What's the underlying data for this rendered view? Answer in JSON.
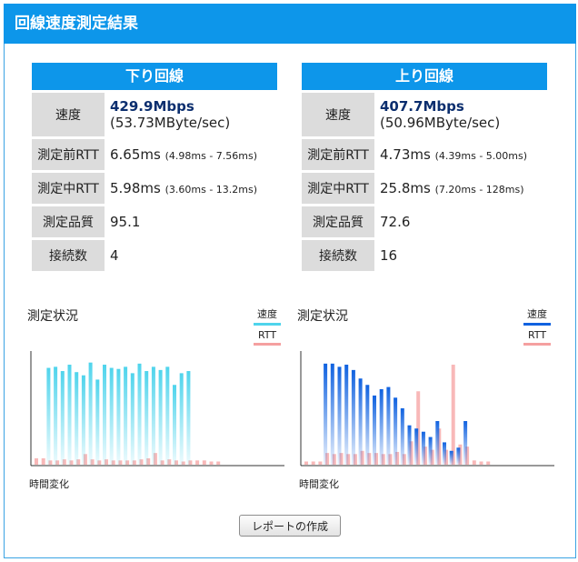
{
  "header": {
    "title": "回線速度測定結果"
  },
  "download": {
    "title": "下り回線",
    "speed_label": "速度",
    "speed_value": "429.9Mbps",
    "speed_sub": "(53.73MByte/sec)",
    "rtt_before_label": "測定前RTT",
    "rtt_before_value": "6.65ms",
    "rtt_before_range": "(4.98ms - 7.56ms)",
    "rtt_during_label": "測定中RTT",
    "rtt_during_value": "5.98ms",
    "rtt_during_range": "(3.60ms - 13.2ms)",
    "quality_label": "測定品質",
    "quality_value": "95.1",
    "connections_label": "接続数",
    "connections_value": "4"
  },
  "upload": {
    "title": "上り回線",
    "speed_label": "速度",
    "speed_value": "407.7Mbps",
    "speed_sub": "(50.96MByte/sec)",
    "rtt_before_label": "測定前RTT",
    "rtt_before_value": "4.73ms",
    "rtt_before_range": "(4.39ms - 5.00ms)",
    "rtt_during_label": "測定中RTT",
    "rtt_during_value": "25.8ms",
    "rtt_during_range": "(7.20ms - 128ms)",
    "quality_label": "測定品質",
    "quality_value": "72.6",
    "connections_label": "接続数",
    "connections_value": "16"
  },
  "charts": {
    "title": "測定状況",
    "legend_speed": "速度",
    "legend_rtt": "RTT",
    "x_label": "時間変化"
  },
  "colors": {
    "header_bg": "#0d96ea",
    "down_speed": "#4fd4ec",
    "up_speed": "#1062e0",
    "rtt": "#f5a0a0"
  },
  "report_button": {
    "label": "レポートの作成"
  },
  "chart_data": [
    {
      "type": "bar",
      "title": "測定状況",
      "xlabel": "時間変化",
      "ylabel": "",
      "ylim": [
        0,
        1
      ],
      "legend": "top-right",
      "grid": false,
      "series": [
        {
          "name": "速度",
          "values": [
            0,
            0,
            0.91,
            0.92,
            0.88,
            0.94,
            0.87,
            0.84,
            0.96,
            0.8,
            0.94,
            0.91,
            0.9,
            0.92,
            0.86,
            0.95,
            0.88,
            0.92,
            0.89,
            0.92,
            0.75,
            0.86,
            0.88,
            0,
            0,
            0,
            0
          ]
        },
        {
          "name": "RTT",
          "values": [
            0.06,
            0.06,
            0.04,
            0.04,
            0.05,
            0.04,
            0.05,
            0.1,
            0.05,
            0.04,
            0.05,
            0.04,
            0.04,
            0.04,
            0.04,
            0.05,
            0.06,
            0.11,
            0.04,
            0.05,
            0.04,
            0.03,
            0.04,
            0.04,
            0.04,
            0.03,
            0.03
          ]
        }
      ]
    },
    {
      "type": "bar",
      "title": "測定状況",
      "xlabel": "時間変化",
      "ylabel": "",
      "ylim": [
        0,
        1
      ],
      "legend": "top-right",
      "grid": false,
      "series": [
        {
          "name": "速度",
          "values": [
            0,
            0,
            0,
            0.95,
            0.95,
            0.92,
            0.94,
            0.89,
            0.81,
            0.75,
            0.65,
            0.71,
            0.73,
            0.63,
            0.53,
            0.37,
            0.34,
            0.31,
            0.26,
            0.41,
            0.21,
            0.13,
            0.16,
            0.41,
            0,
            0,
            0
          ]
        },
        {
          "name": "RTT",
          "values": [
            0.03,
            0.03,
            0.03,
            0.11,
            0.1,
            0.11,
            0.1,
            0.1,
            0.13,
            0.11,
            0.11,
            0.1,
            0.1,
            0.12,
            0.1,
            0.22,
            0.69,
            0.17,
            0.14,
            0.34,
            0.14,
            0.94,
            0.19,
            0.17,
            0.04,
            0.03,
            0.03
          ]
        }
      ]
    }
  ]
}
